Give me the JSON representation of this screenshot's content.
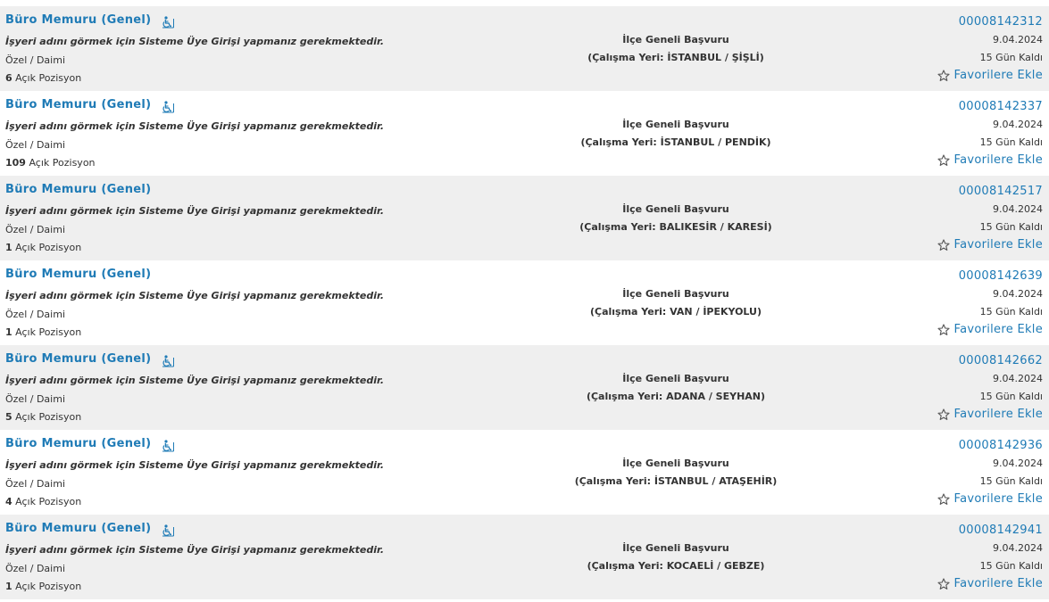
{
  "listings": [
    {
      "title": "Büro Memuru (Genel)",
      "accessible": true,
      "notice": "İşyeri adını görmek için Sisteme Üye Girişi yapmanız gerekmektedir.",
      "type": "Özel / Daimi",
      "positions_count": "6",
      "positions_label": "Açık Pozisyon",
      "application_type": "İlçe Geneli Başvuru",
      "location": "(Çalışma Yeri: İSTANBUL / ŞİŞLİ)",
      "listing_no": "00008142312",
      "date": "9.04.2024",
      "days_left": "15 Gün Kaldı",
      "favorite_label": "Favorilere Ekle"
    },
    {
      "title": "Büro Memuru (Genel)",
      "accessible": true,
      "notice": "İşyeri adını görmek için Sisteme Üye Girişi yapmanız gerekmektedir.",
      "type": "Özel / Daimi",
      "positions_count": "109",
      "positions_label": "Açık Pozisyon",
      "application_type": "İlçe Geneli Başvuru",
      "location": "(Çalışma Yeri: İSTANBUL / PENDİK)",
      "listing_no": "00008142337",
      "date": "9.04.2024",
      "days_left": "15 Gün Kaldı",
      "favorite_label": "Favorilere Ekle"
    },
    {
      "title": "Büro Memuru (Genel)",
      "accessible": false,
      "notice": "İşyeri adını görmek için Sisteme Üye Girişi yapmanız gerekmektedir.",
      "type": "Özel / Daimi",
      "positions_count": "1",
      "positions_label": "Açık Pozisyon",
      "application_type": "İlçe Geneli Başvuru",
      "location": "(Çalışma Yeri: BALIKESİR / KARESİ)",
      "listing_no": "00008142517",
      "date": "9.04.2024",
      "days_left": "15 Gün Kaldı",
      "favorite_label": "Favorilere Ekle"
    },
    {
      "title": "Büro Memuru (Genel)",
      "accessible": false,
      "notice": "İşyeri adını görmek için Sisteme Üye Girişi yapmanız gerekmektedir.",
      "type": "Özel / Daimi",
      "positions_count": "1",
      "positions_label": "Açık Pozisyon",
      "application_type": "İlçe Geneli Başvuru",
      "location": "(Çalışma Yeri: VAN / İPEKYOLU)",
      "listing_no": "00008142639",
      "date": "9.04.2024",
      "days_left": "15 Gün Kaldı",
      "favorite_label": "Favorilere Ekle"
    },
    {
      "title": "Büro Memuru (Genel)",
      "accessible": true,
      "notice": "İşyeri adını görmek için Sisteme Üye Girişi yapmanız gerekmektedir.",
      "type": "Özel / Daimi",
      "positions_count": "5",
      "positions_label": "Açık Pozisyon",
      "application_type": "İlçe Geneli Başvuru",
      "location": "(Çalışma Yeri: ADANA / SEYHAN)",
      "listing_no": "00008142662",
      "date": "9.04.2024",
      "days_left": "15 Gün Kaldı",
      "favorite_label": "Favorilere Ekle"
    },
    {
      "title": "Büro Memuru (Genel)",
      "accessible": true,
      "notice": "İşyeri adını görmek için Sisteme Üye Girişi yapmanız gerekmektedir.",
      "type": "Özel / Daimi",
      "positions_count": "4",
      "positions_label": "Açık Pozisyon",
      "application_type": "İlçe Geneli Başvuru",
      "location": "(Çalışma Yeri: İSTANBUL / ATAŞEHİR)",
      "listing_no": "00008142936",
      "date": "9.04.2024",
      "days_left": "15 Gün Kaldı",
      "favorite_label": "Favorilere Ekle"
    },
    {
      "title": "Büro Memuru (Genel)",
      "accessible": true,
      "notice": "İşyeri adını görmek için Sisteme Üye Girişi yapmanız gerekmektedir.",
      "type": "Özel / Daimi",
      "positions_count": "1",
      "positions_label": "Açık Pozisyon",
      "application_type": "İlçe Geneli Başvuru",
      "location": "(Çalışma Yeri: KOCAELİ / GEBZE)",
      "listing_no": "00008142941",
      "date": "9.04.2024",
      "days_left": "15 Gün Kaldı",
      "favorite_label": "Favorilere Ekle"
    }
  ],
  "icons": {
    "accessibility": "wheelchair-icon",
    "favorite": "star-icon"
  },
  "colors": {
    "link": "#1f7bb6",
    "row_shade": "#efefef",
    "text": "#333333"
  }
}
